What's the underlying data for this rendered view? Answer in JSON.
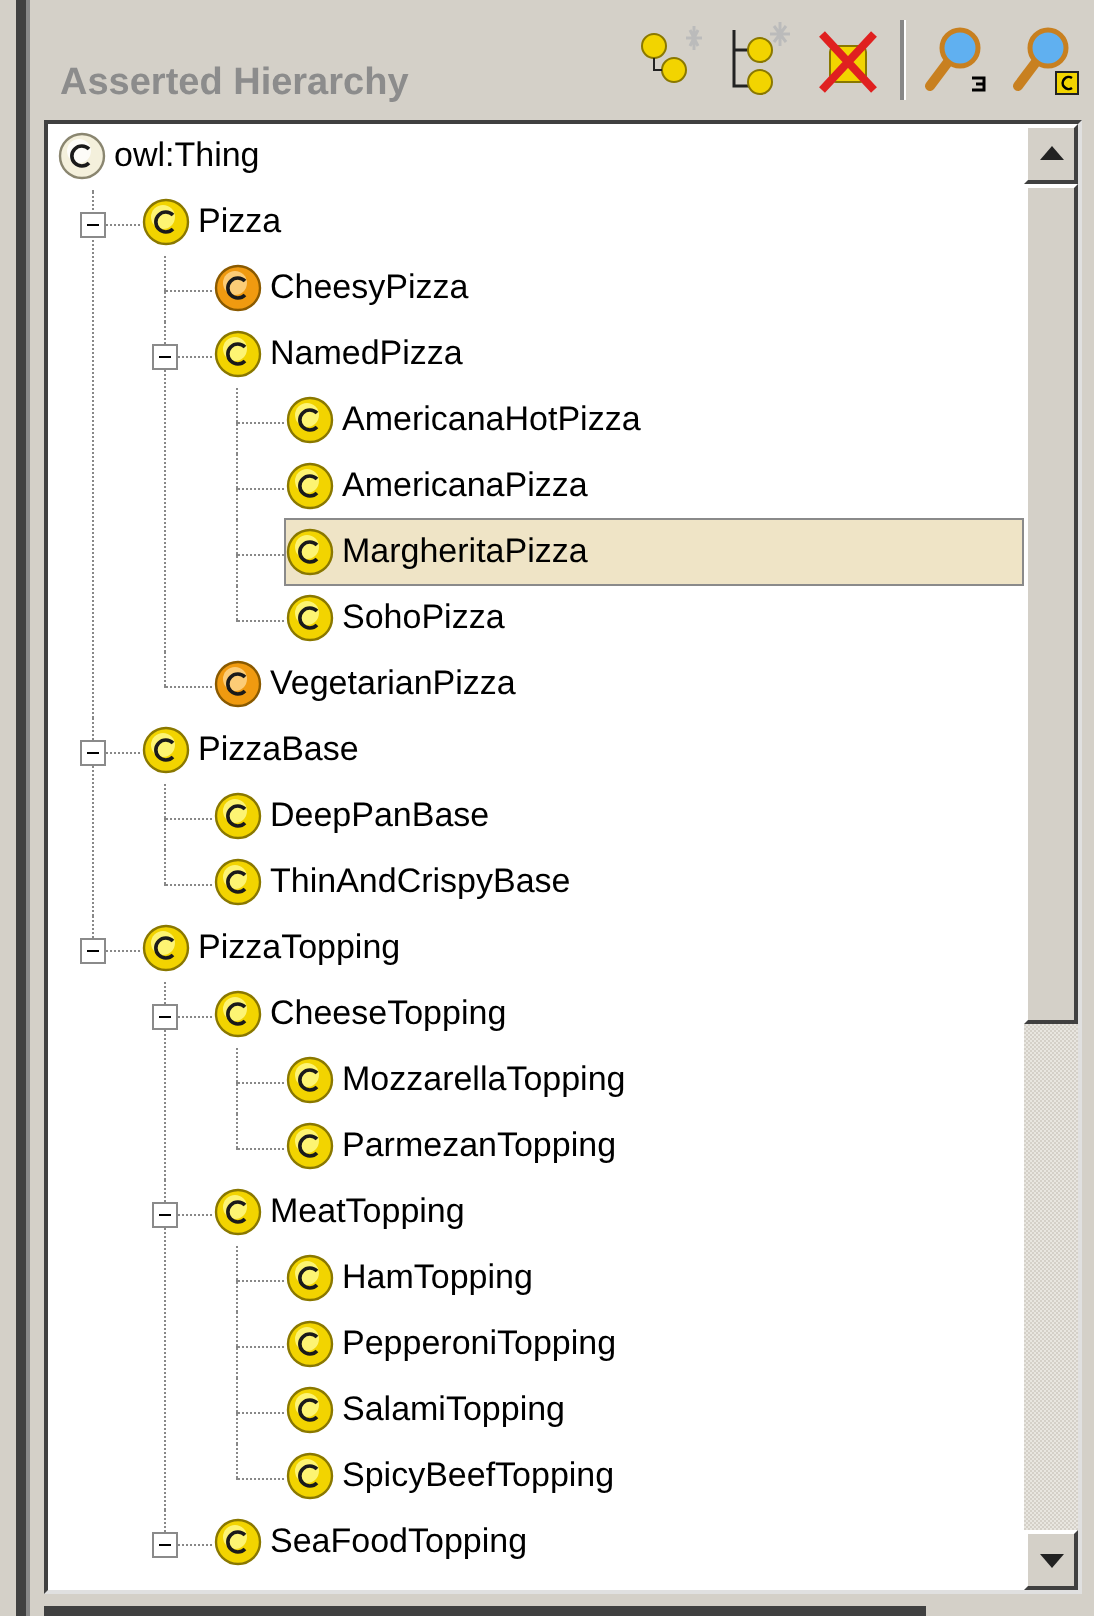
{
  "panel": {
    "title": "Asserted Hierarchy"
  },
  "toolbar": [
    {
      "kind": "add-subclass"
    },
    {
      "kind": "add-sibling"
    },
    {
      "kind": "delete"
    },
    {
      "kind": "separator"
    },
    {
      "kind": "find"
    },
    {
      "kind": "find-class"
    }
  ],
  "tree": {
    "label": "owl:Thing",
    "kind": "thing",
    "selected": false,
    "children": [
      {
        "label": "Pizza",
        "kind": "primitive",
        "selected": false,
        "expanded": true,
        "children": [
          {
            "label": "CheesyPizza",
            "kind": "defined",
            "selected": false
          },
          {
            "label": "NamedPizza",
            "kind": "primitive",
            "selected": false,
            "expanded": true,
            "children": [
              {
                "label": "AmericanaHotPizza",
                "kind": "primitive",
                "selected": false
              },
              {
                "label": "AmericanaPizza",
                "kind": "primitive",
                "selected": false
              },
              {
                "label": "MargheritaPizza",
                "kind": "primitive",
                "selected": true
              },
              {
                "label": "SohoPizza",
                "kind": "primitive",
                "selected": false
              }
            ]
          },
          {
            "label": "VegetarianPizza",
            "kind": "defined",
            "selected": false
          }
        ]
      },
      {
        "label": "PizzaBase",
        "kind": "primitive",
        "selected": false,
        "expanded": true,
        "children": [
          {
            "label": "DeepPanBase",
            "kind": "primitive",
            "selected": false
          },
          {
            "label": "ThinAndCrispyBase",
            "kind": "primitive",
            "selected": false
          }
        ]
      },
      {
        "label": "PizzaTopping",
        "kind": "primitive",
        "selected": false,
        "expanded": true,
        "children": [
          {
            "label": "CheeseTopping",
            "kind": "primitive",
            "selected": false,
            "expanded": true,
            "children": [
              {
                "label": "MozzarellaTopping",
                "kind": "primitive",
                "selected": false
              },
              {
                "label": "ParmezanTopping",
                "kind": "primitive",
                "selected": false
              }
            ]
          },
          {
            "label": "MeatTopping",
            "kind": "primitive",
            "selected": false,
            "expanded": true,
            "children": [
              {
                "label": "HamTopping",
                "kind": "primitive",
                "selected": false
              },
              {
                "label": "PepperoniTopping",
                "kind": "primitive",
                "selected": false
              },
              {
                "label": "SalamiTopping",
                "kind": "primitive",
                "selected": false
              },
              {
                "label": "SpicyBeefTopping",
                "kind": "primitive",
                "selected": false
              }
            ]
          },
          {
            "label": "SeaFoodTopping",
            "kind": "primitive",
            "selected": false,
            "expanded": true
          }
        ]
      }
    ]
  }
}
